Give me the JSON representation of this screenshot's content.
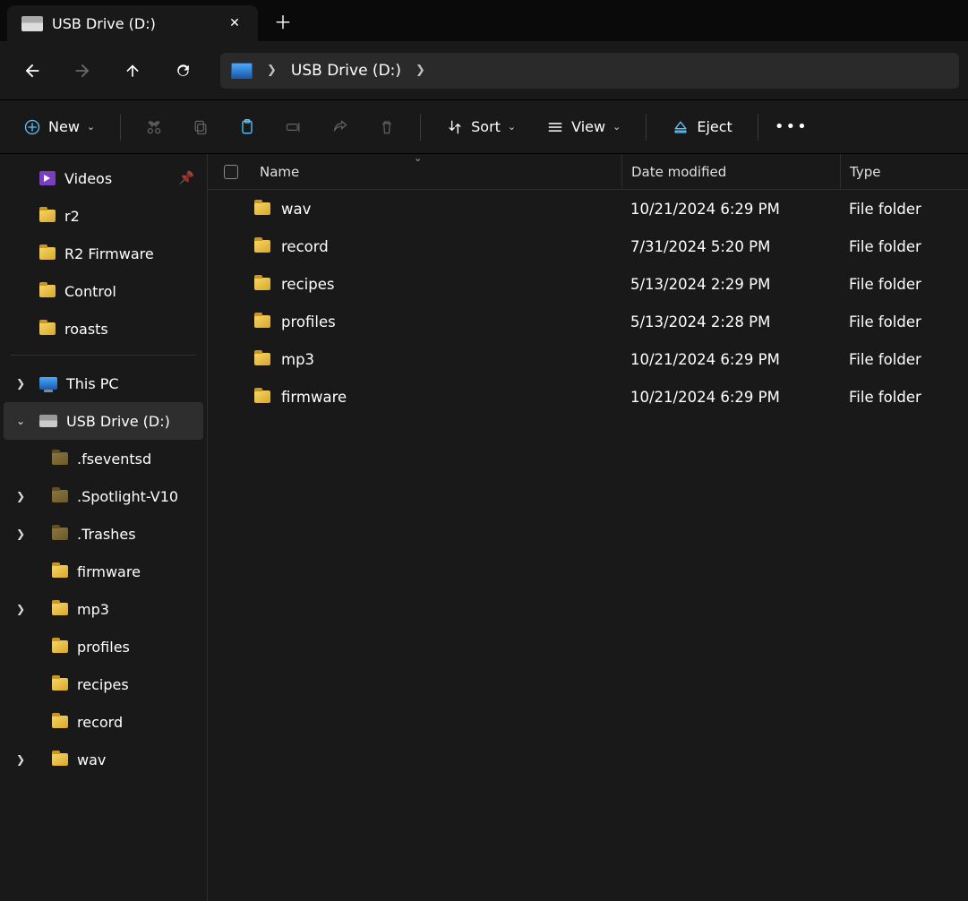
{
  "tab": {
    "title": "USB Drive (D:)"
  },
  "breadcrumb": {
    "path": "USB Drive (D:)"
  },
  "toolbar": {
    "new_label": "New",
    "sort_label": "Sort",
    "view_label": "View",
    "eject_label": "Eject"
  },
  "sidebar": {
    "quick": [
      {
        "label": "Videos",
        "icon": "video",
        "pinned": true
      },
      {
        "label": "r2",
        "icon": "folder"
      },
      {
        "label": "R2 Firmware",
        "icon": "folder"
      },
      {
        "label": "Control",
        "icon": "folder"
      },
      {
        "label": "roasts",
        "icon": "folder"
      }
    ],
    "this_pc_label": "This PC",
    "usb_label": "USB Drive (D:)",
    "usb_children": [
      {
        "label": ".fseventsd",
        "dim": true,
        "expandable": false
      },
      {
        "label": ".Spotlight-V10",
        "dim": true,
        "expandable": true
      },
      {
        "label": ".Trashes",
        "dim": true,
        "expandable": true
      },
      {
        "label": "firmware",
        "dim": false,
        "expandable": false
      },
      {
        "label": "mp3",
        "dim": false,
        "expandable": true
      },
      {
        "label": "profiles",
        "dim": false,
        "expandable": false
      },
      {
        "label": "recipes",
        "dim": false,
        "expandable": false
      },
      {
        "label": "record",
        "dim": false,
        "expandable": false
      },
      {
        "label": "wav",
        "dim": false,
        "expandable": true
      }
    ]
  },
  "list": {
    "headers": {
      "name": "Name",
      "date": "Date modified",
      "type": "Type"
    },
    "rows": [
      {
        "name": "wav",
        "date": "10/21/2024 6:29 PM",
        "type": "File folder"
      },
      {
        "name": "record",
        "date": "7/31/2024 5:20 PM",
        "type": "File folder"
      },
      {
        "name": "recipes",
        "date": "5/13/2024 2:29 PM",
        "type": "File folder"
      },
      {
        "name": "profiles",
        "date": "5/13/2024 2:28 PM",
        "type": "File folder"
      },
      {
        "name": "mp3",
        "date": "10/21/2024 6:29 PM",
        "type": "File folder"
      },
      {
        "name": "firmware",
        "date": "10/21/2024 6:29 PM",
        "type": "File folder"
      }
    ]
  }
}
